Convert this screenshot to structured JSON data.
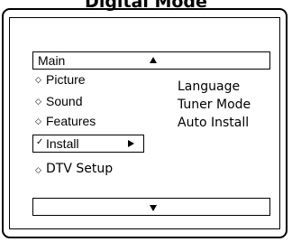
{
  "heading": "Digital Mode",
  "menu": {
    "header_label": "Main",
    "items": [
      {
        "label": "Picture",
        "icon": "diamond-icon"
      },
      {
        "label": "Sound",
        "icon": "diamond-icon"
      },
      {
        "label": "Features",
        "icon": "diamond-icon"
      },
      {
        "label": "Install",
        "icon": "checkmark-icon",
        "selected": true
      },
      {
        "label": "DTV Setup",
        "icon": "diamond-icon"
      }
    ]
  },
  "submenu": {
    "items": [
      "Language",
      "Tuner Mode",
      "Auto Install"
    ]
  },
  "glyphs": {
    "diamond": "◇",
    "check": "✓"
  }
}
